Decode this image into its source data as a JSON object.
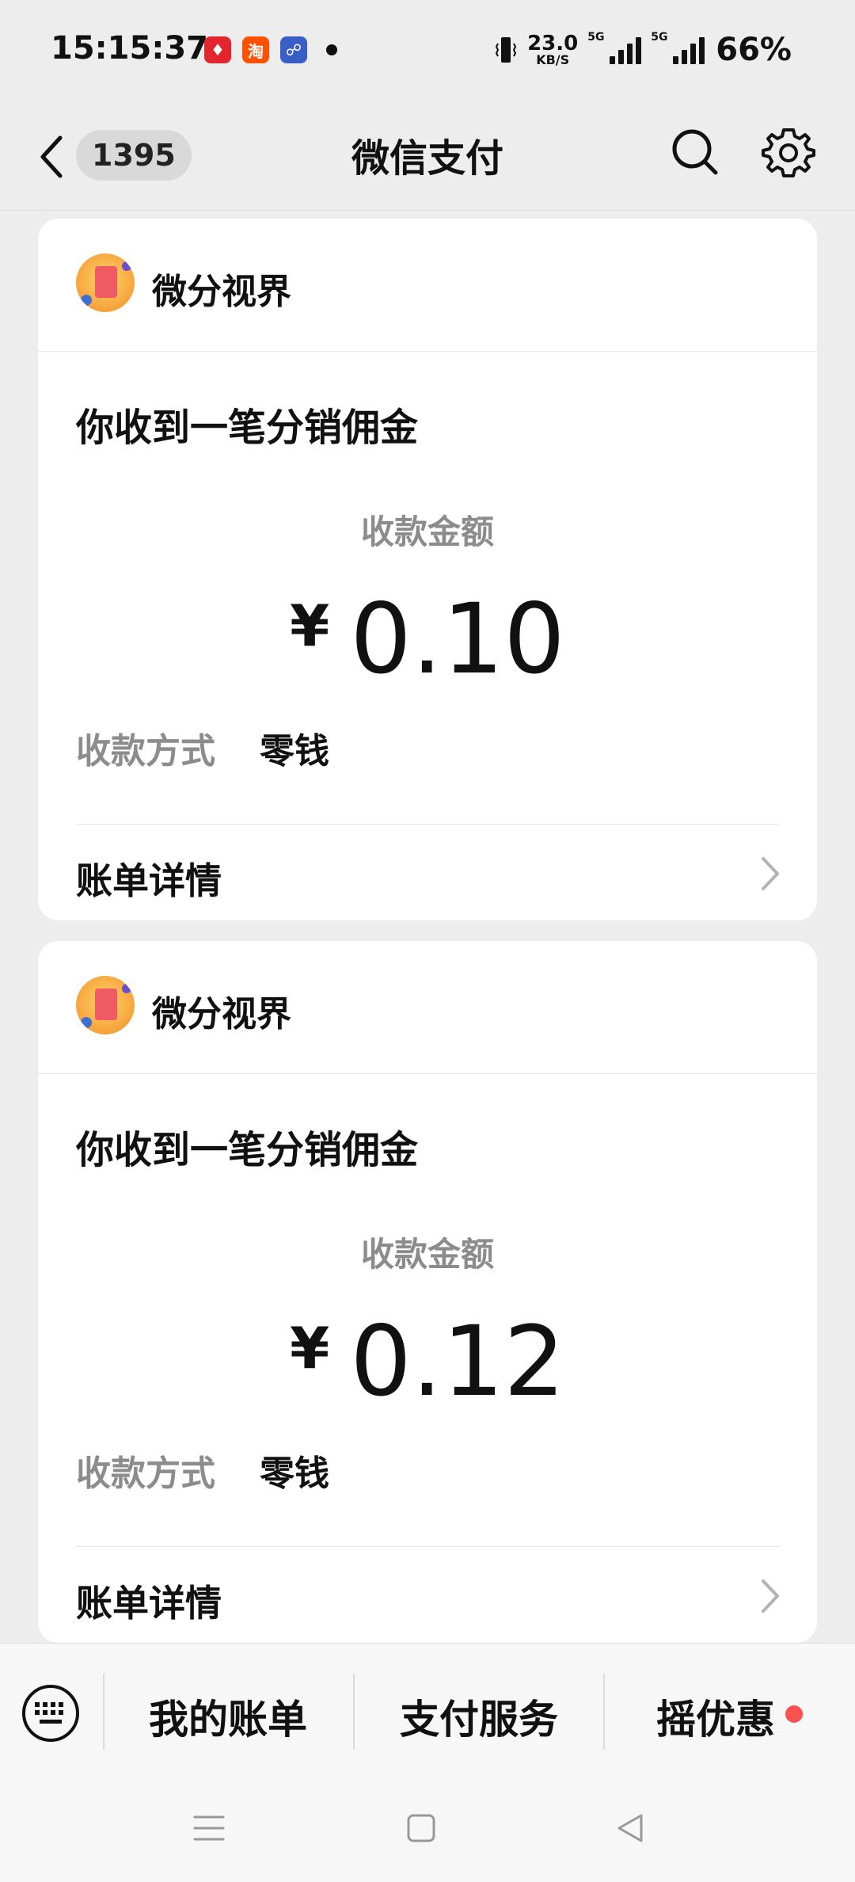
{
  "status_bar": {
    "time": "15:15:37",
    "apps": [
      {
        "name": "app-icon-securities",
        "glyph": "♦",
        "color": "#e3262e"
      },
      {
        "name": "app-icon-taobao",
        "glyph": "淘",
        "color": "#ff5000"
      },
      {
        "name": "app-icon-bank",
        "glyph": "☍",
        "color": "#3a5ec8"
      }
    ],
    "net_speed_value": "23.0",
    "net_speed_unit": "KB/S",
    "signal_tag_1": "5G",
    "signal_tag_2": "5G",
    "battery": "66%"
  },
  "nav": {
    "badge": "1395",
    "title": "微信支付"
  },
  "cards": [
    {
      "merchant": "微分视界",
      "title": "你收到一笔分销佣金",
      "amount_label": "收款金额",
      "currency": "¥",
      "amount": "0.10",
      "method_label": "收款方式",
      "method_value": "零钱",
      "detail_label": "账单详情"
    },
    {
      "merchant": "微分视界",
      "title": "你收到一笔分销佣金",
      "amount_label": "收款金额",
      "currency": "¥",
      "amount": "0.12",
      "method_label": "收款方式",
      "method_value": "零钱",
      "detail_label": "账单详情"
    }
  ],
  "bottom_menu": {
    "items": [
      "我的账单",
      "支付服务",
      "摇优惠"
    ]
  },
  "colors": {
    "background": "#ededed",
    "card": "#ffffff",
    "muted_text": "#8c8c8c",
    "red_dot": "#fa5151"
  }
}
